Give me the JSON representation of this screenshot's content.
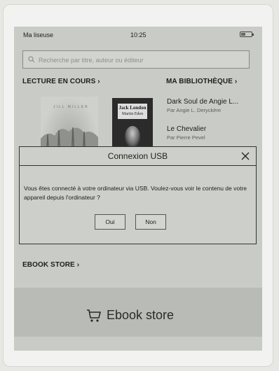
{
  "status_bar": {
    "library_label": "Ma liseuse",
    "time": "10:25"
  },
  "search": {
    "placeholder": "Recherche par titre, auteur ou éditeur"
  },
  "sections": {
    "reading": "LECTURE EN COURS ›",
    "library": "MA BIBLIOTHÈQUE ›",
    "store": "EBOOK STORE ›"
  },
  "covers": {
    "book1_author": "JILL MILLER",
    "book2_title": "Jack London",
    "book2_subtitle": "Martin Eden"
  },
  "library": [
    {
      "title": "Dark Soul de Angie L...",
      "author": "Par Angie L. Deryckère"
    },
    {
      "title": "Le Chevalier",
      "author": "Par Pierre Pevel"
    }
  ],
  "dialog": {
    "title": "Connexion USB",
    "message": "Vous êtes connecté à votre ordinateur via USB. Voulez-vous voir le contenu de votre appareil depuis l'ordinateur ?",
    "yes_label": "Oui",
    "no_label": "Non"
  },
  "store_banner": {
    "label": "Ebook store"
  },
  "icons": {
    "search": "search-icon",
    "battery": "battery-icon",
    "close": "close-icon",
    "cart": "cart-icon"
  }
}
